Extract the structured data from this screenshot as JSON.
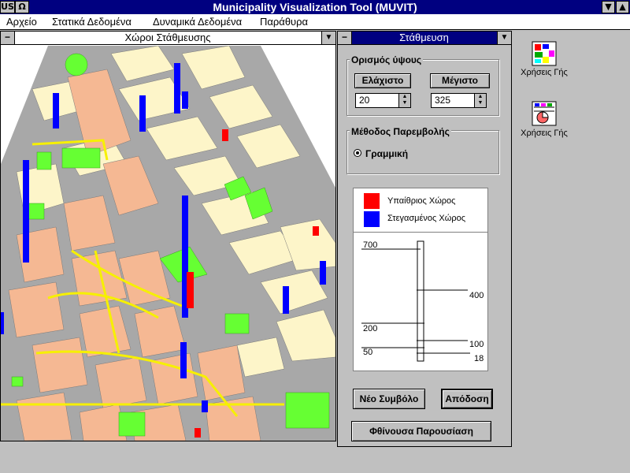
{
  "app": {
    "title": "Municipality Visualization Tool (MUVIT)",
    "left_btn1": "US",
    "left_btn2": "Ω"
  },
  "menu": [
    "Αρχείο",
    "Στατικά Δεδομένα",
    "Δυναμικά Δεδομένα",
    "Παράθυρα"
  ],
  "map_window": {
    "title": "Χώροι Στάθμευσης"
  },
  "parking_window": {
    "title": "Στάθμευση",
    "height_group": {
      "label": "Ορισμός ύψους",
      "min_button": "Ελάχιστο",
      "max_button": "Μέγιστο",
      "min_value": "20",
      "max_value": "325"
    },
    "interp_group": {
      "label": "Μέθοδος Παρεμβολής",
      "option": "Γραμμική"
    },
    "legend": [
      {
        "label": "Υπαίθριος Χώρος",
        "color": "#ff0000"
      },
      {
        "label": "Στεγασμένος Χώρος",
        "color": "#0000ff"
      }
    ],
    "scale_ticks": [
      "700",
      "400",
      "200",
      "100",
      "50",
      "18"
    ],
    "new_symbol_button": "Νέο Συμβόλο",
    "render_button": "Απόδοση",
    "descending_button": "Φθίνουσα Παρουσίαση"
  },
  "desktop_icons": [
    {
      "label": "Χρήσεις Γής",
      "icon": "landuse-map-icon"
    },
    {
      "label": "Χρήσεις Γής",
      "icon": "landuse-chart-icon"
    }
  ]
}
